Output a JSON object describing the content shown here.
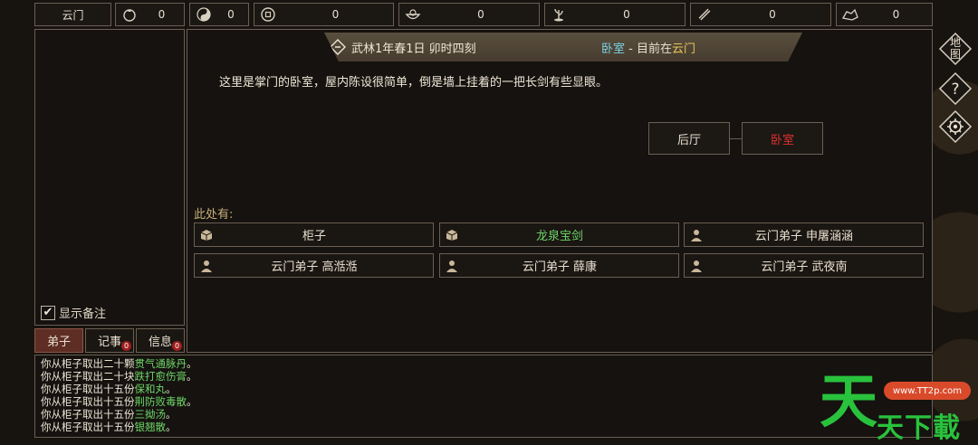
{
  "sect_name": "云门",
  "resources": [
    {
      "icon": "coin-pouch-icon",
      "value": "0"
    },
    {
      "icon": "taiji-icon",
      "value": "0"
    },
    {
      "icon": "copper-coin-icon",
      "value": "0"
    },
    {
      "icon": "food-bowl-icon",
      "value": "0"
    },
    {
      "icon": "herb-icon",
      "value": "0"
    },
    {
      "icon": "scroll-icon",
      "value": "0"
    },
    {
      "icon": "ore-icon",
      "value": "0"
    }
  ],
  "left_panel": {
    "notes_label": "显示备注",
    "notes_checked": true
  },
  "tabs": [
    {
      "label": "弟子",
      "badge": ""
    },
    {
      "label": "记事",
      "badge": "0"
    },
    {
      "label": "信息",
      "badge": "0"
    }
  ],
  "banner": {
    "date": "武林1年春1日 卯时四刻",
    "room": "卧室",
    "separator": " - 目前在",
    "place": "云门"
  },
  "description": "这里是掌门的卧室，屋内陈设很简单，倒是墙上挂着的一把长剑有些显眼。",
  "rooms": [
    {
      "label": "后厅",
      "current": false
    },
    {
      "label": "卧室",
      "current": true
    }
  ],
  "here_label": "此处有:",
  "objects": [
    {
      "icon": "box-icon",
      "label": "柜子",
      "highlight": false
    },
    {
      "icon": "box-icon",
      "label": "龙泉宝剑",
      "highlight": true
    },
    {
      "icon": "person-icon",
      "label": "云门弟子 申屠涵涵",
      "highlight": false
    },
    {
      "icon": "person-icon",
      "label": "云门弟子 高湉湉",
      "highlight": false
    },
    {
      "icon": "person-icon",
      "label": "云门弟子 薛康",
      "highlight": false
    },
    {
      "icon": "person-icon",
      "label": "云门弟子 武夜南",
      "highlight": false
    }
  ],
  "side_buttons": [
    {
      "icon": "map-icon",
      "label": "地图"
    },
    {
      "icon": "help-icon",
      "label": "?"
    },
    {
      "icon": "settings-gear-icon",
      "label": ""
    }
  ],
  "log": [
    {
      "prefix": "你从柜子取出二十颗",
      "item": "贯气通脉丹",
      "suffix": "。"
    },
    {
      "prefix": "你从柜子取出二十块",
      "item": "跌打愈伤膏",
      "suffix": "。"
    },
    {
      "prefix": "你从柜子取出十五份",
      "item": "保和丸",
      "suffix": "。"
    },
    {
      "prefix": "你从柜子取出十五份",
      "item": "荆防败毒散",
      "suffix": "。"
    },
    {
      "prefix": "你从柜子取出十五份",
      "item": "三拗汤",
      "suffix": "。"
    },
    {
      "prefix": "你从柜子取出十五份",
      "item": "银翘散",
      "suffix": "。"
    }
  ],
  "watermark": {
    "big": "天",
    "small": "天下載",
    "url": "www.TT2p.com"
  },
  "colors": {
    "room_current": "#e03030",
    "item_highlight": "#6fd66a",
    "room_name": "#7ad3e6",
    "place_name": "#e7c458",
    "tab_active": "#5e2d24"
  }
}
